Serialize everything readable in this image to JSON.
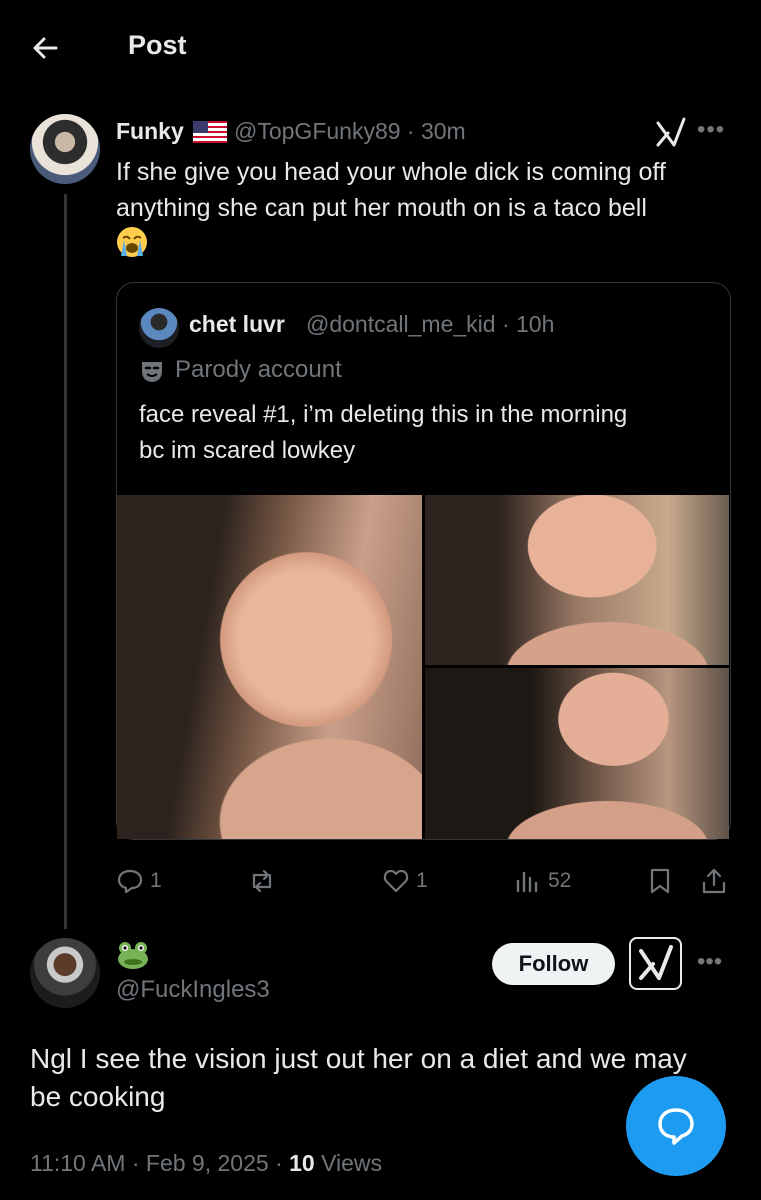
{
  "header": {
    "title": "Post",
    "back_icon": "arrow-left-icon"
  },
  "post": {
    "name": "Funky",
    "name_badge": "us-flag-emoji",
    "handle_time": "@TopGFunky89 · 30m",
    "text_line1": "If she give you head your whole dick is coming off",
    "text_line2": "anything she can put her mouth on is a taco bell",
    "emoji": "loudly-crying-face-emoji"
  },
  "quote": {
    "name": "chet luvr",
    "handle_time": "@dontcall_me_kid · 10h",
    "label": "Parody account",
    "text_line1": "face reveal #1, i’m deleting this in the morning",
    "text_line2": "bc im scared lowkey"
  },
  "actions": {
    "replies": "1",
    "reposts": "",
    "likes": "1",
    "views": "52"
  },
  "reply": {
    "name_emoji": "frog-emoji",
    "handle": "@FuckIngles3",
    "follow_label": "Follow",
    "text": "Ngl I see the vision just out her on a diet and we may be cooking",
    "timestamp": "11:10 AM · Feb 9, 2025 · ",
    "views_count": "10",
    "views_label": " Views"
  },
  "colors": {
    "background": "#000000",
    "text": "#e7e9ea",
    "secondary": "#71767b",
    "accent": "#1d9bf0",
    "border": "#333639"
  }
}
